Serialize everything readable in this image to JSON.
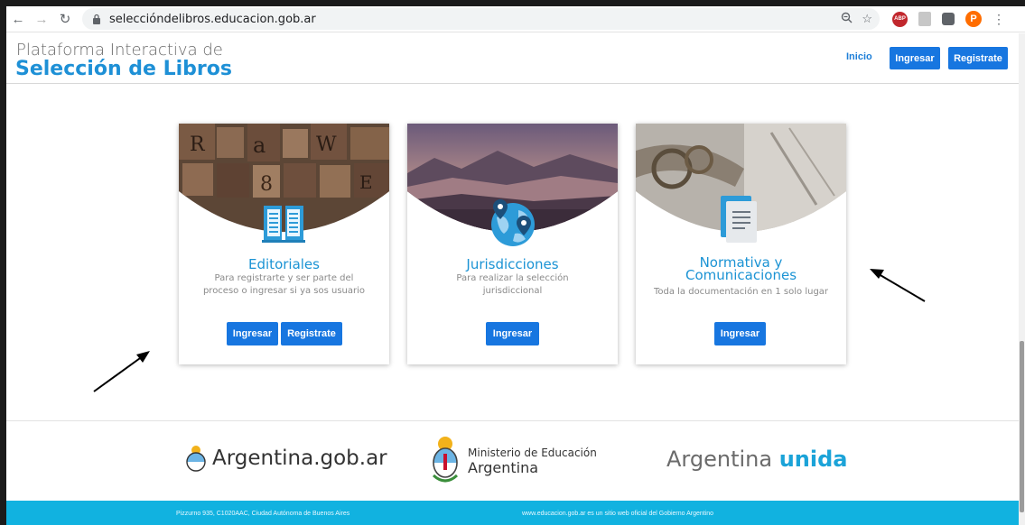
{
  "browser": {
    "url": "seleccióndelibros.educacion.gob.ar",
    "extensions": {
      "abp_label": "ABP",
      "profile_initial": "P"
    }
  },
  "header": {
    "logo_top": "Plataforma Interactiva de",
    "logo_bottom": "Selección de Libros",
    "nav": {
      "inicio": "Inicio",
      "ingresar": "Ingresar",
      "registrate": "Registrate"
    }
  },
  "cards": [
    {
      "title": "Editoriales",
      "desc_line1": "Para registrarte y ser parte del",
      "desc_line2": "proceso o ingresar si ya sos usuario",
      "buttons": [
        "Ingresar",
        "Registrate"
      ],
      "icon": "book-icon"
    },
    {
      "title": "Jurisdicciones",
      "desc_line1": "Para realizar la selección",
      "desc_line2": "jurisdiccional",
      "buttons": [
        "Ingresar"
      ],
      "icon": "map-globe-icon"
    },
    {
      "title_line1": "Normativa y",
      "title_line2": "Comunicaciones",
      "desc_line1": "Toda la documentación en 1 solo lugar",
      "buttons": [
        "Ingresar"
      ],
      "icon": "document-icon"
    }
  ],
  "footer": {
    "argentina_gob": "Argentina.gob.ar",
    "ministerio_line1": "Ministerio de Educación",
    "ministerio_line2": "Argentina",
    "unida_plain": "Argentina",
    "unida_bold": "unida",
    "address": "Pizzurno 935, C1020AAC, Ciudad Autónoma de Buenos Aires",
    "official": "www.educacion.gob.ar es un sitio web oficial del Gobierno Argentino"
  },
  "colors": {
    "brand_blue": "#1e90d6",
    "button_blue": "#1776e0",
    "footer_cyan": "#11b2e0"
  }
}
